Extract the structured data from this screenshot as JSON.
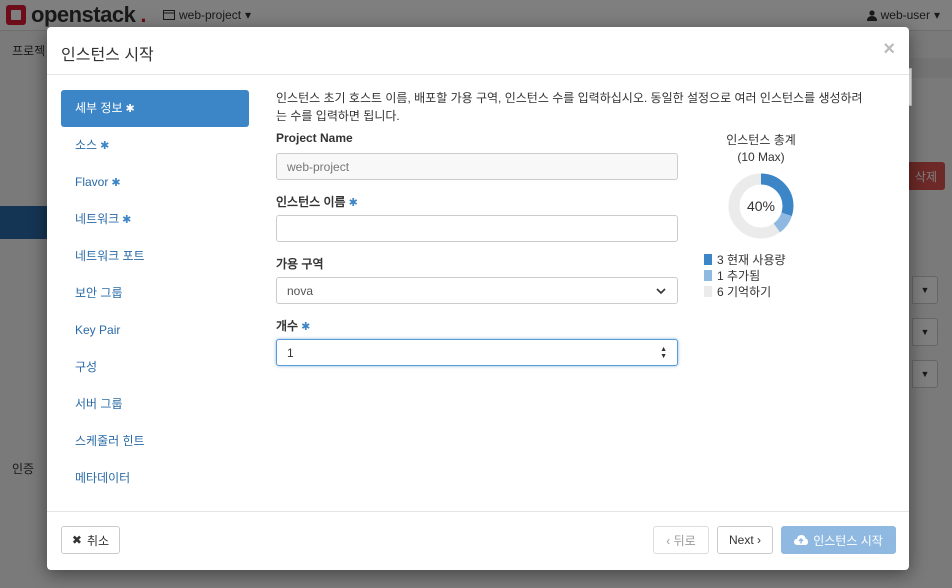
{
  "background": {
    "brand": "openstack",
    "project_switcher": "web-project",
    "user_menu": "web-user",
    "left_label": "프로젝ト",
    "auth_label": "인증",
    "delete_label": "삭제"
  },
  "modal": {
    "title": "인스턴스 시작",
    "close_glyph": "×",
    "help_glyph": "?",
    "nav": [
      {
        "label": "세부 정보",
        "required": true,
        "active": true
      },
      {
        "label": "소스",
        "required": true,
        "active": false
      },
      {
        "label": "Flavor",
        "required": true,
        "active": false
      },
      {
        "label": "네트워크",
        "required": true,
        "active": false
      },
      {
        "label": "네트워크 포트",
        "required": false,
        "active": false
      },
      {
        "label": "보안 그룹",
        "required": false,
        "active": false
      },
      {
        "label": "Key Pair",
        "required": false,
        "active": false
      },
      {
        "label": "구성",
        "required": false,
        "active": false
      },
      {
        "label": "서버 그룹",
        "required": false,
        "active": false
      },
      {
        "label": "스케줄러 힌트",
        "required": false,
        "active": false
      },
      {
        "label": "메타데이터",
        "required": false,
        "active": false
      }
    ],
    "description": "인스턴스 초기 호스트 이름, 배포할 가용 구역, 인스턴스 수를 입력하십시오. 동일한 설정으로 여러 인스턴스를 생성하려는 수를 입력하면 됩니다.",
    "form": {
      "project_name_label": "Project Name",
      "project_name_value": "web-project",
      "instance_name_label": "인스턴스 이름",
      "instance_name_value": "",
      "az_label": "가용 구역",
      "az_value": "nova",
      "count_label": "개수",
      "count_value": "1"
    },
    "usage": {
      "title": "인스턴스 총계",
      "subtitle": "(10 Max)",
      "percent_label": "40%",
      "current": 3,
      "added": 1,
      "remaining": 6,
      "max": 10,
      "legend": [
        {
          "text": "3 현재 사용량",
          "color": "#3c85c6"
        },
        {
          "text": "1 추가됨",
          "color": "#8fb9e1"
        },
        {
          "text": "6 기억하기",
          "color": "#ebebeb"
        }
      ]
    },
    "footer": {
      "cancel": "취소",
      "back": "‹ 뒤로",
      "next": "Next ›",
      "launch": "인스턴스 시작"
    }
  },
  "colors": {
    "accent": "#3c85c6",
    "accent_light": "#8fb9e1",
    "brand_red": "#da1a32",
    "danger": "#d9534f"
  }
}
